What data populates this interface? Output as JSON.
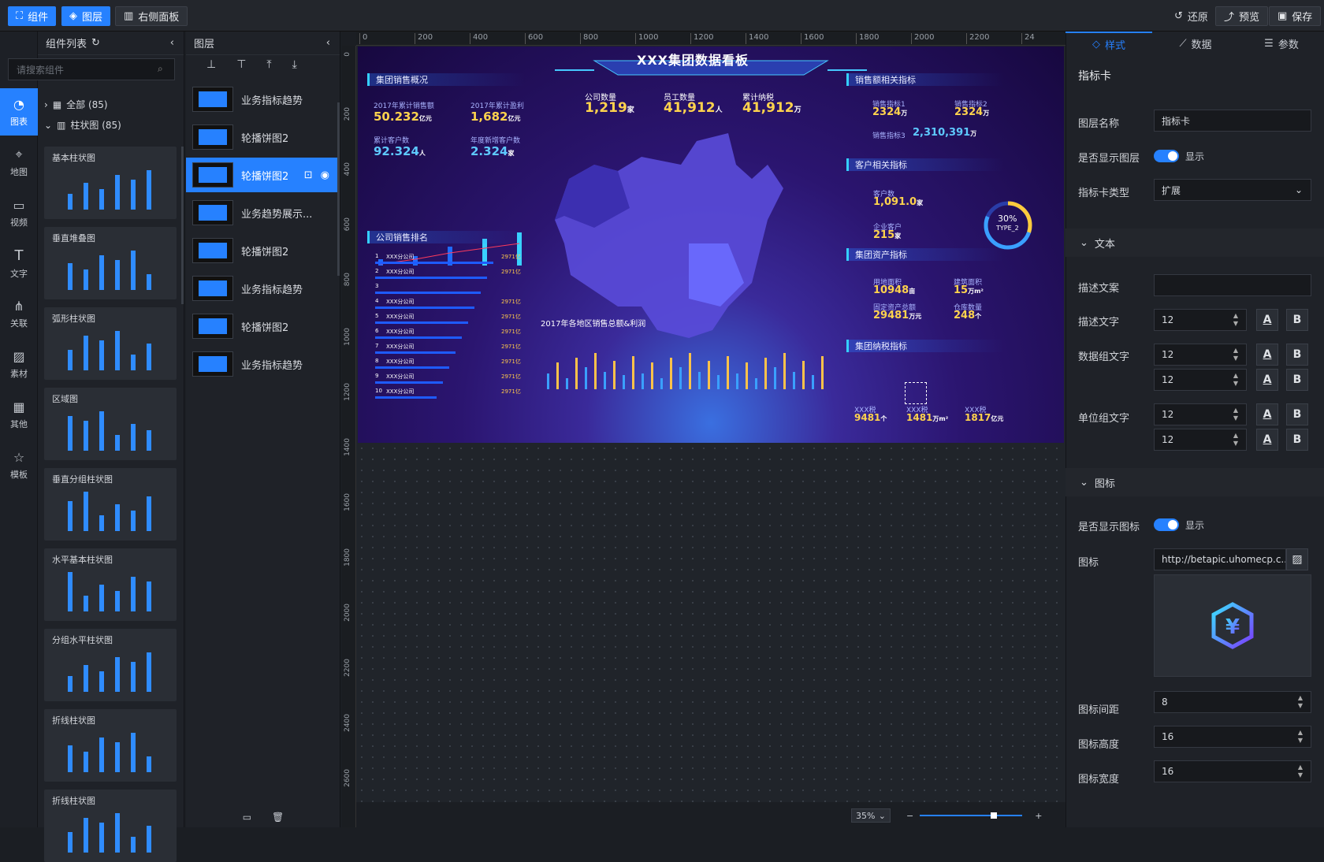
{
  "topbar": {
    "components_btn": "组件",
    "layers_btn": "图层",
    "right_panel_btn": "右侧面板",
    "restore": "还原",
    "preview": "预览",
    "save": "保存"
  },
  "rail": {
    "items": [
      "图表",
      "地图",
      "视频",
      "文字",
      "关联",
      "素材",
      "其他",
      "模板"
    ]
  },
  "complist": {
    "title": "组件列表",
    "search_placeholder": "请搜索组件",
    "tree_all": "全部 (85)",
    "tree_bar": "柱状图 (85)",
    "thumbs": [
      "基本柱状图",
      "垂直堆叠图",
      "弧形柱状图",
      "区域图",
      "垂直分组柱状图",
      "水平基本柱状图",
      "分组水平柱状图",
      "折线柱状图",
      "折线柱状图"
    ]
  },
  "layers": {
    "title": "图层",
    "items": [
      "业务指标趋势",
      "轮播饼图2",
      "轮播饼图2",
      "业务趋势展示...",
      "轮播饼图2",
      "业务指标趋势",
      "轮播饼图2",
      "业务指标趋势"
    ],
    "selected_index": 2
  },
  "ruler": {
    "h": [
      "0",
      "200",
      "400",
      "600",
      "800",
      "1000",
      "1200",
      "1400",
      "1600",
      "1800",
      "2000",
      "2200",
      "24"
    ],
    "v": [
      "0",
      "200",
      "400",
      "600",
      "800",
      "1000",
      "1200",
      "1400",
      "1600",
      "1800",
      "2000",
      "2200",
      "2400",
      "2600"
    ]
  },
  "board": {
    "title": "XXX集团数据看板",
    "sec_sales": "集团销售概况",
    "s1_label": "2017年累计销售额",
    "s1_val": "50.232",
    "s1_unit": "亿元",
    "s2_label": "2017年累计盈利",
    "s2_val": "1,682",
    "s2_unit": "亿元",
    "s3_label": "累计客户数",
    "s3_val": "92.324",
    "s3_unit": "人",
    "s4_label": "年度新增客户数",
    "s4_val": "2.324",
    "s4_unit": "家",
    "top_kpis": [
      {
        "label": "公司数量",
        "val": "1,219",
        "unit": "家"
      },
      {
        "label": "员工数量",
        "val": "41,912",
        "unit": "人"
      },
      {
        "label": "累计纳税",
        "val": "41,912",
        "unit": "万"
      }
    ],
    "sec_rank": "公司销售排名",
    "rank": [
      {
        "n": "1",
        "name": "XXX分公司",
        "v": "2971亿"
      },
      {
        "n": "2",
        "name": "XXX分公司",
        "v": "2971亿"
      },
      {
        "n": "3",
        "name": "",
        "v": ""
      },
      {
        "n": "4",
        "name": "XXX分公司",
        "v": "2971亿"
      },
      {
        "n": "5",
        "name": "XXX分公司",
        "v": "2971亿"
      },
      {
        "n": "6",
        "name": "XXX分公司",
        "v": "2971亿"
      },
      {
        "n": "7",
        "name": "XXX分公司",
        "v": "2971亿"
      },
      {
        "n": "8",
        "name": "XXX分公司",
        "v": "2971亿"
      },
      {
        "n": "9",
        "name": "XXX分公司",
        "v": "2971亿"
      },
      {
        "n": "10",
        "name": "XXX分公司",
        "v": "2971亿"
      }
    ],
    "map_chart_title": "2017年各地区销售总额&利润",
    "sec_sales_kpi": "销售额相关指标",
    "sk1_label": "销售指标1",
    "sk1_val": "2324",
    "sk1_unit": "万",
    "sk2_label": "销售指标2",
    "sk2_val": "2324",
    "sk2_unit": "万",
    "sk3_label": "销售指标3",
    "sk3_val": "2,310,391",
    "sk3_unit": "万",
    "sec_customer": "客户相关指标",
    "c1_label": "客户数",
    "c1_val": "1,091.0",
    "c1_unit": "家",
    "c2_label": "企业客户",
    "c2_val": "215",
    "c2_unit": "家",
    "ring_pct": "30%",
    "ring_label": "TYPE_2",
    "sec_assets": "集团资产指标",
    "a1_label": "用地面积",
    "a1_val": "10948",
    "a1_unit": "亩",
    "a2_label": "建筑面积",
    "a2_val": "15",
    "a2_unit": "万m²",
    "a3_label": "固定资产总额",
    "a3_val": "29481",
    "a3_unit": "万元",
    "a4_label": "仓库数量",
    "a4_val": "248",
    "a4_unit": "个",
    "sec_tax": "集团纳税指标",
    "t1_label": "XXX税",
    "t1_val": "9481",
    "t1_unit": "个",
    "t2_label": "XXX税",
    "t2_val": "1481",
    "t2_unit": "万m²",
    "t3_label": "XXX税",
    "t3_val": "1817",
    "t3_unit": "亿元"
  },
  "zoom": {
    "level": "35%"
  },
  "rpanel": {
    "tabs": [
      "样式",
      "数据",
      "参数"
    ],
    "title": "指标卡",
    "layer_name_label": "图层名称",
    "layer_name_value": "指标卡",
    "show_layer_label": "是否显示图层",
    "show_text": "显示",
    "card_type_label": "指标卡类型",
    "card_type_value": "扩展",
    "section_text": "文本",
    "desc_copy_label": "描述文案",
    "desc_copy_value": "",
    "desc_text_label": "描述文字",
    "desc_text_size": "12",
    "data_text_label": "数据组文字",
    "data_text_size1": "12",
    "data_text_size2": "12",
    "unit_text_label": "单位组文字",
    "unit_text_size1": "12",
    "unit_text_size2": "12",
    "section_icon": "图标",
    "show_icon_label": "是否显示图标",
    "icon_label": "图标",
    "icon_url": "http://betapic.uhomecp.c...",
    "icon_gap_label": "图标间距",
    "icon_gap": "8",
    "icon_height_label": "图标高度",
    "icon_height": "16",
    "icon_width_label": "图标宽度",
    "icon_width": "16"
  }
}
